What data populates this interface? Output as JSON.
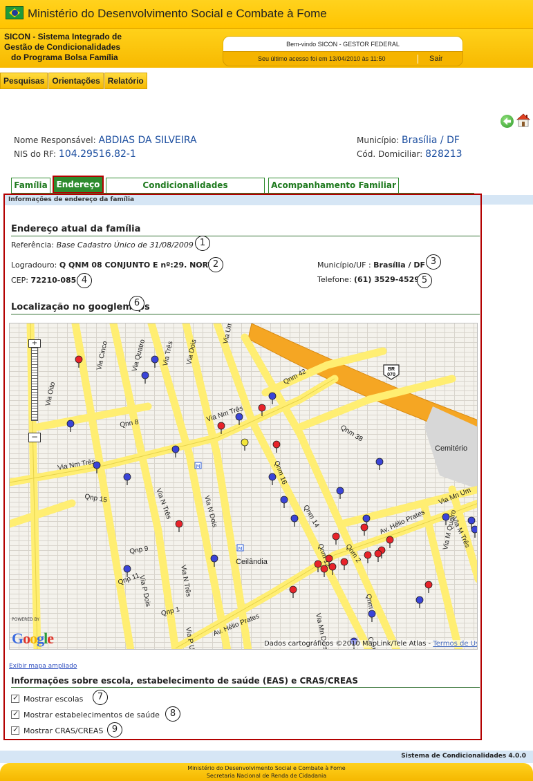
{
  "header": {
    "ministry_title": "Ministério do Desenvolvimento Social e Combate à Fome",
    "system_name_lines": [
      "SICON - Sistema Integrado de",
      "Gestão de Condicionalidades",
      "do Programa Bolsa Família"
    ],
    "welcome": "Bem-vindo SICON - GESTOR FEDERAL",
    "last_access": "Seu último acesso foi em 13/04/2010 às 11:50",
    "logout": "Sair"
  },
  "menu": [
    "Pesquisas",
    "Orientações",
    "Relatório"
  ],
  "nav_icons": [
    "back-arrow-icon",
    "home-icon"
  ],
  "person": {
    "responsavel_label": "Nome Responsável:",
    "responsavel_value": "ABDIAS DA SILVEIRA",
    "nis_label": "NIS do RF:",
    "nis_value": "104.29516.82-1",
    "municipio_label": "Município:",
    "municipio_value": "Brasília / DF",
    "cod_label": "Cód. Domiciliar:",
    "cod_value": "828213"
  },
  "tabs": [
    "Família",
    "Endereço",
    "Condicionalidades",
    "Acompanhamento Familiar"
  ],
  "section": {
    "title": "Informações de endereço da família",
    "address_heading": "Endereço atual da família",
    "referencia_label": "Referência:",
    "referencia_value": "Base Cadastro Único de 31/08/2009",
    "logradouro_label": "Logradouro:",
    "logradouro_value": "Q QNM 08 CONJUNTO E nº:29. NORTE",
    "cep_label": "CEP:",
    "cep_value": "72210-085",
    "municipio_label": "Município/UF :",
    "municipio_value": "Brasília / DF",
    "telefone_label": "Telefone:",
    "telefone_value": "(61) 3529-4529",
    "map_heading": "Localização no googlemaps",
    "expand_map": "Exibir mapa ampliado",
    "services_heading": "Informações sobre escola, estabelecimento de saúde (EAS) e CRAS/CREAS",
    "checks": [
      "Mostrar escolas",
      "Mostrar estabelecimentos de saúde",
      "Mostrar CRAS/CREAS"
    ]
  },
  "badges": [
    "1",
    "2",
    "3",
    "4",
    "5",
    "6",
    "7",
    "8",
    "9"
  ],
  "map": {
    "labels": {
      "via_oito": "Via Oito",
      "via_cinco": "Via Cinco",
      "via_quatro": "Via Quatro",
      "via_tres": "Via Três",
      "via_dois": "Via Dois",
      "via_um": "Via Um",
      "qnm42": "Qnm 42",
      "qnm38": "Qnm 38",
      "qnn8": "Qnn 8",
      "via_nm_tres_top": "Via Nm Três",
      "via_nm_tres_left": "Via Nm Três",
      "qnm16": "Qnm 16",
      "qnm14": "Qnm 14",
      "qnm12": "Qnm 12",
      "qnm11": "Qnm 11",
      "qnm13": "Qnm 13",
      "qnm2": "Qnm 2",
      "qnp15": "Qnp 15",
      "qnp9": "Qnp 9",
      "qnp11": "Qnp 11",
      "qnp1": "Qnp 1",
      "via_n_tres": "Via N Três",
      "via_n_dois": "Via N Dois",
      "via_n_tres_b": "Via N Três",
      "via_p_dois": "Via P Dois",
      "via_p_um": "Via P Um",
      "av_helio_prates": "Av. Hélio Prates",
      "av_helio_prates_b": "Av. Hélio Prates",
      "via_mn_um": "Via Mn Um",
      "via_m_tres": "Via M Três",
      "via_m_quatro": "Via M Quatro",
      "via_mn_dois": "Via Mn Dois",
      "ceilandia": "Ceilândia",
      "cemiterio": "Cemitério",
      "br": "BR",
      "br_num": "070",
      "metro": "M"
    },
    "powered_by": "POWERED BY",
    "google": "Google",
    "credits": "Dados cartográficos ©2010 MapLink/Tele Atlas - ",
    "terms": "Termos de Uso"
  },
  "colors": {
    "brand_yellow": "#ffc400",
    "tab_green": "#2e8b2e",
    "frame_red": "#b30000",
    "link_blue": "#1d4fa0",
    "marker_red": "#e8232a",
    "marker_blue": "#3a44d8",
    "marker_yellow": "#f3e63a"
  },
  "footer": {
    "version": "Sistema de Condicionalidades 4.0.0",
    "line1": "Ministério do Desenvolvimento Social e Combate à Fome",
    "line2": "Secretaria Nacional de Renda de Cidadania"
  }
}
